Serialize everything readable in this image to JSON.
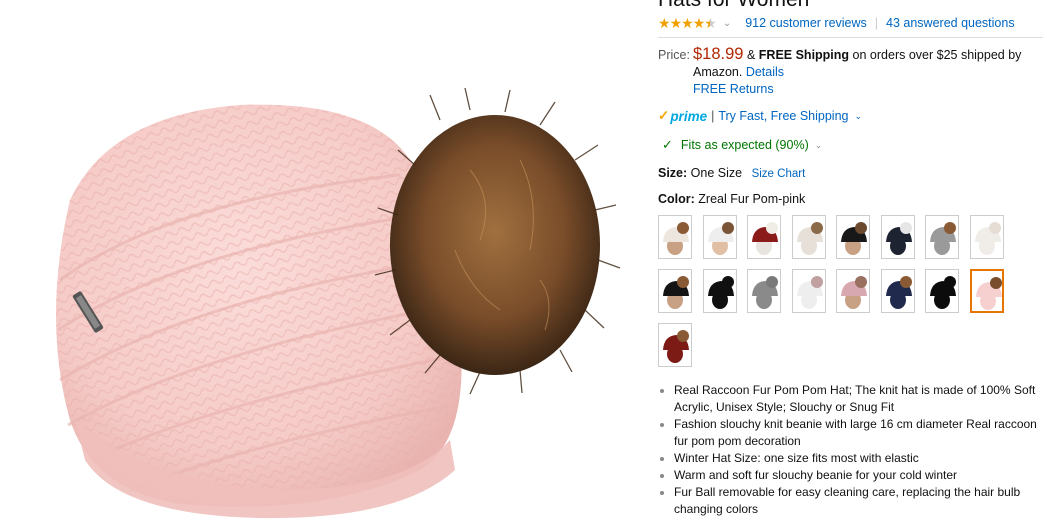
{
  "product": {
    "title": "Hats for Women",
    "rating": {
      "stars": 4.5,
      "reviews_link": "912 customer reviews",
      "questions_link": "43 answered questions"
    },
    "price": {
      "label": "Price:",
      "amount": "$18.99",
      "amp": "&",
      "free_shipping": "FREE Shipping",
      "shipping_text": "on orders over $25 shipped by Amazon.",
      "details_link": "Details",
      "free_returns_link": "FREE Returns"
    },
    "prime": {
      "logo_text": "prime",
      "divider": "|",
      "try_link": "Try Fast, Free Shipping"
    },
    "fit": {
      "text": "Fits as expected (90%)"
    },
    "size": {
      "label": "Size:",
      "value": "One Size",
      "chart_link": "Size Chart"
    },
    "color": {
      "label": "Color:",
      "value": "Zreal Fur Pom-pink"
    },
    "swatches": [
      {
        "hat": "#ece6df",
        "pom": "#8a5a35",
        "bg": "#fff",
        "hair": "#c8a184"
      },
      {
        "hat": "#eee",
        "pom": "#7b5436",
        "bg": "#fff",
        "hair": "#e0bfa5"
      },
      {
        "hat": "#8b1a1a",
        "pom": "#f0ece6",
        "bg": "#fff",
        "hair": "#e8e4df"
      },
      {
        "hat": "#e6e0d8",
        "pom": "#8a6a48",
        "bg": "#fff",
        "hair": "#e6e0d8"
      },
      {
        "hat": "#181818",
        "pom": "#6b4a30",
        "bg": "#fff",
        "hair": "#c8a184"
      },
      {
        "hat": "#1d2330",
        "pom": "#e6e6e6",
        "bg": "#fff",
        "hair": "#1d2330"
      },
      {
        "hat": "#9a9a9a",
        "pom": "#8a5a35",
        "bg": "#fff",
        "hair": "#9a9a9a"
      },
      {
        "hat": "#f0ece8",
        "pom": "#e6ded5",
        "bg": "#fff",
        "hair": "#f0ece8"
      },
      {
        "hat": "#141414",
        "pom": "#8a5a35",
        "bg": "#fff",
        "hair": "#c8a184"
      },
      {
        "hat": "#101010",
        "pom": "#101010",
        "bg": "#fff",
        "hair": "#101010"
      },
      {
        "hat": "#8a8a8a",
        "pom": "#7a7a7a",
        "bg": "#fff",
        "hair": "#8a8a8a"
      },
      {
        "hat": "#eeeeee",
        "pom": "#c0a0a0",
        "bg": "#fff",
        "hair": "#eeeeee"
      },
      {
        "hat": "#d8a8b0",
        "pom": "#9a7060",
        "bg": "#fff",
        "hair": "#c8a184"
      },
      {
        "hat": "#1f2a4d",
        "pom": "#8a5a35",
        "bg": "#fff",
        "hair": "#1f2a4d"
      },
      {
        "hat": "#0c0c0c",
        "pom": "#0c0c0c",
        "bg": "#fff",
        "hair": "#0c0c0c"
      },
      {
        "hat": "#f6cfcf",
        "pom": "#7a4e2c",
        "bg": "#fff",
        "hair": "#f6cfcf"
      },
      {
        "hat": "#7c1a16",
        "pom": "#8a5a35",
        "bg": "#fff",
        "hair": "#7c1a16"
      }
    ],
    "selected_swatch": 15,
    "bullets": [
      "Real Raccoon Fur Pom Pom Hat; The knit hat is made of 100% Soft Acrylic, Unisex Style; Slouchy or Snug Fit",
      "Fashion slouchy knit beanie with large 16 cm diameter Real raccoon fur pom pom decoration",
      "Winter Hat Size: one size fits most with elastic",
      "Warm and soft fur slouchy beanie for your cold winter",
      "Fur Ball removable for easy cleaning care, replacing the hair bulb changing colors"
    ],
    "colors": {
      "price": "#b12704",
      "link": "#0066c0",
      "fit_green": "#007600",
      "prime_blue": "#00a8e1",
      "selected_border": "#e77600",
      "hat_pink": "#f6d2d0",
      "pom_brown": "#8a5a35"
    }
  }
}
